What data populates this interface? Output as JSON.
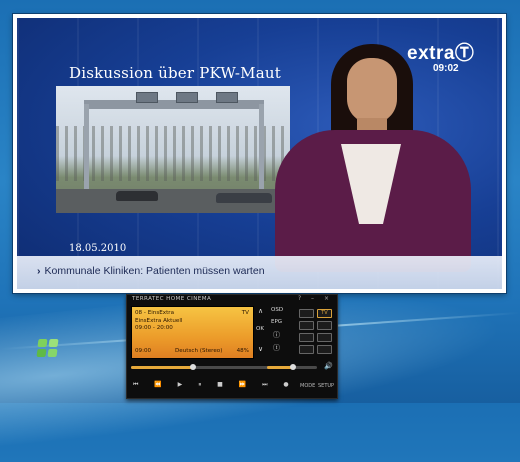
{
  "video": {
    "headline": "Diskussion über PKW-Maut",
    "date": "18.05.2010",
    "channel_logo": "extraⓉ",
    "clock": "09:02",
    "ticker": "Kommunale Kliniken: Patienten müssen warten",
    "ticker_arrow": "›"
  },
  "player": {
    "title": "TERRATEC HOME CINEMA",
    "window_buttons": "? – ×",
    "channel": "08 - EinsExtra",
    "channel_badge": "TV",
    "program": "EinsExtra Aktuell",
    "program_time": "09:00 - 20:00",
    "current_time": "09:00",
    "audio": "Deutsch (Stereo)",
    "progress_text": "48%",
    "progress_fraction": 0.48,
    "volume_fraction": 0.55,
    "nav": {
      "up": "∧",
      "down": "∨",
      "ok": "OK",
      "osd": "OSD",
      "epg": "EPG",
      "info": "ⓘ",
      "clock": "ⓣ"
    },
    "side_tv_label": "TV",
    "transport": "⏮ ⏪ ▶ ⏸ ■ ⏩ ⏭ ●",
    "mode_label": "MODE",
    "setup_label": "SETUP",
    "speaker_icon": "🔊"
  },
  "colors": {
    "desktop": "#1f73b8",
    "lcd": "#ec9c2a",
    "accent": "#e6a93a"
  }
}
